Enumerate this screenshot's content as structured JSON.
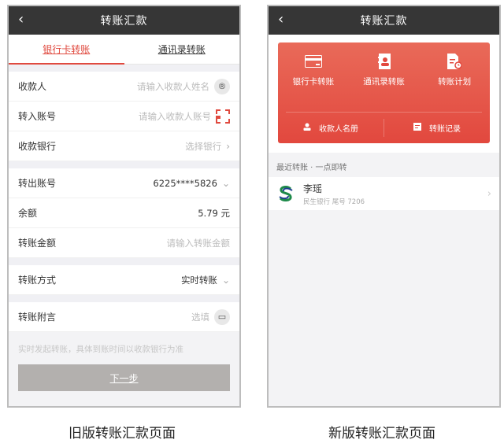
{
  "old": {
    "nav": {
      "back_icon": "chevron-left",
      "title": "转账汇款"
    },
    "tabs": [
      {
        "label": "银行卡转账",
        "active": true
      },
      {
        "label": "通讯录转账",
        "active": false
      }
    ],
    "fields": {
      "payee": {
        "label": "收款人",
        "placeholder": "请输入收款人姓名",
        "icon": "contact-icon"
      },
      "account": {
        "label": "转入账号",
        "placeholder": "请输入收款人账号",
        "icon": "scan-icon"
      },
      "bank": {
        "label": "收款银行",
        "placeholder": "选择银行"
      },
      "from_account": {
        "label": "转出账号",
        "value": "6225****5826"
      },
      "balance": {
        "label": "余额",
        "value": "5.79 元"
      },
      "amount": {
        "label": "转账金额",
        "placeholder": "请输入转账金额"
      },
      "method": {
        "label": "转账方式",
        "value": "实时转账"
      },
      "note": {
        "label": "转账附言",
        "placeholder": "选填",
        "icon": "message-icon"
      }
    },
    "hint": "实时发起转账，具体到账时间以收款银行为准",
    "next_button": "下一步",
    "caption": "旧版转账汇款页面"
  },
  "new": {
    "nav": {
      "back_icon": "chevron-left",
      "title": "转账汇款"
    },
    "card": {
      "functions": [
        {
          "label": "银行卡转账",
          "icon": "bank-card-icon"
        },
        {
          "label": "通讯录转账",
          "icon": "contacts-book-icon"
        },
        {
          "label": "转账计划",
          "icon": "schedule-doc-icon"
        }
      ],
      "links": [
        {
          "label": "收款人名册",
          "icon": "person-icon"
        },
        {
          "label": "转账记录",
          "icon": "record-icon"
        }
      ],
      "color": "#e2483e"
    },
    "recent_title": "最近转账 · 一点即转",
    "recent": [
      {
        "name": "李瑶",
        "meta": "民生银行 尾号 7206"
      }
    ],
    "caption": "新版转账汇款页面"
  }
}
